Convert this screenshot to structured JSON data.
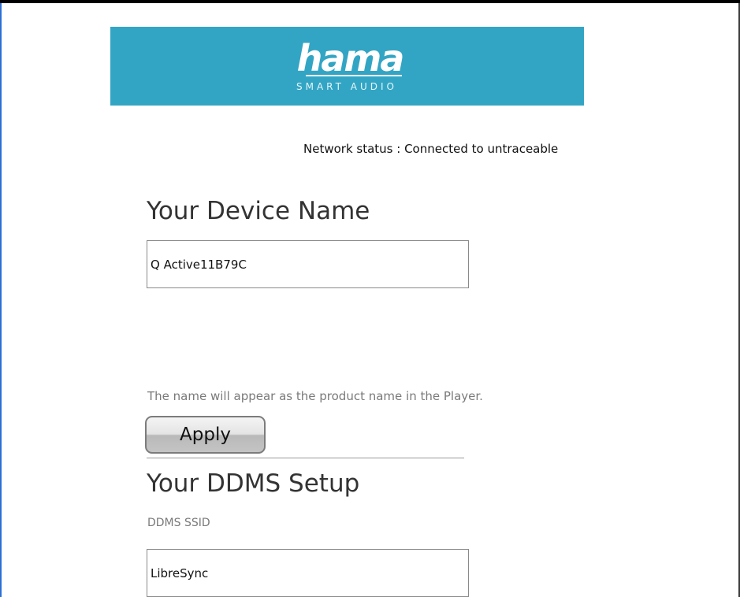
{
  "brand": {
    "logo_text": "hama",
    "logo_subtitle": "SMART AUDIO",
    "banner_color": "#33a5c4"
  },
  "network_status": "Network status : Connected to untraceable",
  "device_name_section": {
    "title": "Your Device Name",
    "value": "Q Active11B79C",
    "hint": "The name will appear as the product name in the Player.",
    "apply_label": "Apply"
  },
  "ddms_section": {
    "title": "Your DDMS Setup",
    "ssid_label": "DDMS SSID",
    "ssid_value": "LibreSync"
  }
}
